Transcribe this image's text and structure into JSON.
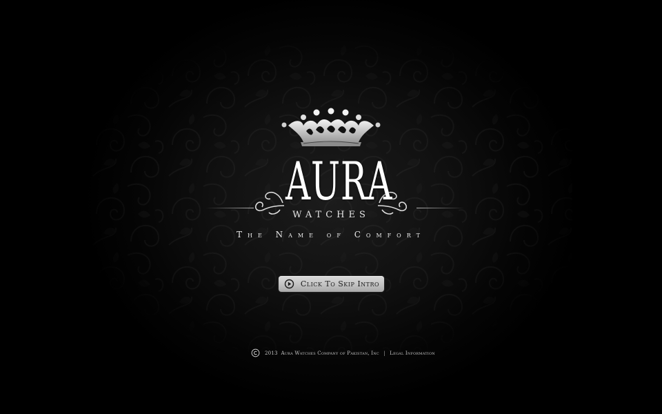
{
  "brand": {
    "name": "AURA",
    "sub": "WATCHES",
    "tagline": "The Name of Comfort"
  },
  "actions": {
    "skip_label": "Click To Skip Intro",
    "skip_icon": "play-arrow-icon"
  },
  "footer": {
    "copyright_icon": "copyright-icon",
    "year": "2013",
    "company": "Aura Watches Company of Pakistan, Inc",
    "separator": "|",
    "legal_link": "Legal Information"
  },
  "colors": {
    "background": "#000000",
    "text": "#ffffff",
    "button": "#c4c4c4",
    "button_text": "#1a1a1a"
  }
}
